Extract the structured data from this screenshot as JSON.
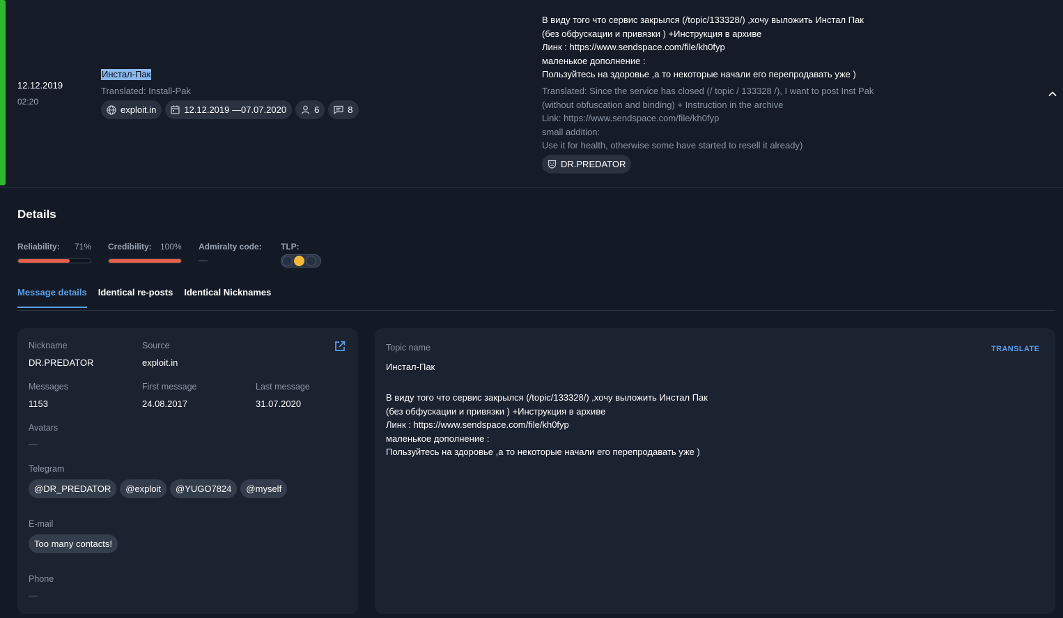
{
  "post": {
    "date": "12.12.2019",
    "time": "02:20",
    "title": "Инстал-Пак",
    "title_translated": "Translated: Install-Pak",
    "source": "exploit.in",
    "date_range": "12.12.2019 —07.07.2020",
    "participants": "6",
    "messages": "8",
    "author": "DR.PREDATOR",
    "message_ru": [
      "В виду того что сервис закрылся (/topic/133328/) ,хочу выложить Инстал Пак",
      "(без обфускации и привязки ) +Инструкция в архиве",
      "Линк : https://www.sendspace.com/file/kh0fyp",
      "маленькое дополнение :",
      "Пользуйтесь на здоровье ,а то некоторые начали его перепродавать уже )"
    ],
    "message_en": [
      "Translated: Since the service has closed (/ topic / 133328 /), I want to post Inst Pak",
      "(without obfuscation and binding) + Instruction in the archive",
      "Link: https://www.sendspace.com/file/kh0fyp",
      "small addition:",
      "Use it for health, otherwise some have started to resell it already)"
    ]
  },
  "details": {
    "title": "Details",
    "reliability_label": "Reliability:",
    "reliability_value": "71%",
    "reliability_level": 0.71,
    "credibility_label": "Credibility:",
    "credibility_value": "100%",
    "credibility_level": 1.0,
    "admiralty_label": "Admiralty code:",
    "admiralty_value": "—",
    "tlp_label": "TLP:",
    "tlp_active": "amber",
    "accent_color": "#e8604c"
  },
  "tabs": [
    "Message details",
    "Identical re-posts",
    "Identical Nicknames"
  ],
  "user": {
    "nickname_label": "Nickname",
    "nickname": "DR.PREDATOR",
    "source_label": "Source",
    "source": "exploit.in",
    "messages_label": "Messages",
    "messages": "1153",
    "first_label": "First message",
    "first": "24.08.2017",
    "last_label": "Last message",
    "last": "31.07.2020",
    "avatars_label": "Avatars",
    "avatars": "—",
    "telegram_label": "Telegram",
    "telegram": [
      "@DR_PREDATOR",
      "@exploit",
      "@YUGO7824",
      "@myself"
    ],
    "email_label": "E-mail",
    "email": "Too many contacts!",
    "phone_label": "Phone",
    "phone": "—"
  },
  "topic": {
    "label": "Topic name",
    "translate_label": "TRANSLATE",
    "name": "Инстал-Пак",
    "body": [
      "В виду того что сервис закрылся (/topic/133328/) ,хочу выложить Инстал Пак",
      "(без обфускации и привязки ) +Инструкция в архиве",
      "Линк : https://www.sendspace.com/file/kh0fyp",
      "маленькое дополнение :",
      "Пользуйтесь на здоровье ,а то некоторые начали его перепродавать уже )"
    ]
  }
}
